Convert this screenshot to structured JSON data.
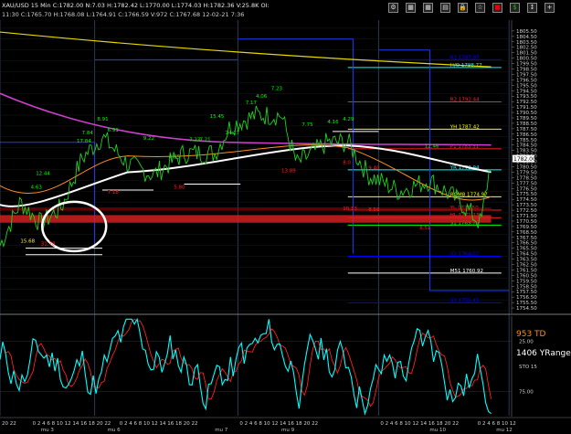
{
  "window": {
    "title_line": "XAU/USD 15 Min C:1782.00 N:7.03 H:1782.42 L:1770.00 L:1774.03 H:1782.36 V:25.8K OI:",
    "info_line": "11:30 C:1765.70 H:1768.08 L:1764.91 C:1766.59 V:972 C:1767.68 12-02-21 7:36",
    "buttons": [
      "settings-icon",
      "grid-icon",
      "grid-icon",
      "calendar-icon",
      "lock-icon",
      "star-icon",
      "red-square-icon",
      "dollar-icon",
      "scroll-icon",
      "crosshair-icon"
    ]
  },
  "chart_data": [
    {
      "type": "line",
      "title": "",
      "panel": "price",
      "yaxis": {
        "min": 1753.5,
        "max": 1807.5,
        "step": 1,
        "label_every": 1,
        "labels_from": 1754.5,
        "labels_to": 1805.5
      },
      "xaxis_labels": [
        "20 22",
        "0 2 4 6 8 10 12 14 16 18 20 22",
        "0 2 4 6 8 10 12 14 16 18 20 22",
        "0 2 4 6 8 10 12 14 16 18 20 22",
        "0 2 4 6 8 10 12 14 16 18 20 22",
        "0 2 4 6 8 10 12"
      ],
      "day_labels": [
        "mu 3",
        "mu 6",
        "mu 7",
        "mu 9",
        "mu 10",
        "mu 12"
      ],
      "price_box": {
        "value": "1782.00",
        "y": 1782.0
      },
      "levels": [
        {
          "label": "H/O 1798.77",
          "y": 1798.77,
          "color": "#00ffff"
        },
        {
          "label": "R1 1787.97",
          "y": 1800.2,
          "color": "#0000ff"
        },
        {
          "label": "R2 1792.44",
          "y": 1792.44,
          "color": "#ff2020"
        },
        {
          "label": "YH 1787.42",
          "y": 1787.42,
          "color": "#ffff00"
        },
        {
          "label": "P1 1783.31",
          "y": 1783.8,
          "color": "#ff2020"
        },
        {
          "label": "YR 1779.94",
          "y": 1779.94,
          "color": "#00ffff"
        },
        {
          "label": "ROM8 1774.97",
          "y": 1774.97,
          "color": "#ffff00"
        },
        {
          "label": "YL 1772.50",
          "y": 1772.5,
          "color": "#ff2020"
        },
        {
          "label": "HL 1771.13",
          "y": 1771.13,
          "color": "#ff2020"
        },
        {
          "label": "S1 1769.75",
          "y": 1769.75,
          "color": "#00ff00"
        },
        {
          "label": "S2 1764.02",
          "y": 1764.02,
          "color": "#0000ff"
        },
        {
          "label": "M51 1760.92",
          "y": 1760.92,
          "color": "#ffffff"
        },
        {
          "label": "S3 1755.45",
          "y": 1755.45,
          "color": "#0000ff"
        }
      ],
      "annotations": [
        {
          "text": "15.68",
          "x": 0.04,
          "y": 1766.5,
          "color": "#ffff00"
        },
        {
          "text": "4.63",
          "x": 0.06,
          "y": 1776.5,
          "color": "#00ff00"
        },
        {
          "text": "12.44",
          "x": 0.07,
          "y": 1779.0,
          "color": "#00ff00"
        },
        {
          "text": "31.78",
          "x": 0.08,
          "y": 1766.0,
          "color": "#ff2020"
        },
        {
          "text": "17.84",
          "x": 0.15,
          "y": 1785.0,
          "color": "#00ff00"
        },
        {
          "text": "7.84",
          "x": 0.16,
          "y": 1786.5,
          "color": "#00ff00"
        },
        {
          "text": "8.91",
          "x": 0.19,
          "y": 1789.0,
          "color": "#00ff00"
        },
        {
          "text": "6.91",
          "x": 0.21,
          "y": 1787.0,
          "color": "#00ff00"
        },
        {
          "text": "9.22",
          "x": 0.28,
          "y": 1785.5,
          "color": "#00ff00"
        },
        {
          "text": "7.18",
          "x": 0.21,
          "y": 1775.5,
          "color": "#ff2020"
        },
        {
          "text": "5.80",
          "x": 0.34,
          "y": 1776.5,
          "color": "#ff2020"
        },
        {
          "text": "4.65",
          "x": 0.33,
          "y": 1782.0,
          "color": "#00ff00"
        },
        {
          "text": "7.23",
          "x": 0.37,
          "y": 1785.2,
          "color": "#00ff00"
        },
        {
          "text": "7.21",
          "x": 0.39,
          "y": 1785.2,
          "color": "#00ff00"
        },
        {
          "text": "15.45",
          "x": 0.41,
          "y": 1789.5,
          "color": "#00ff00"
        },
        {
          "text": "14.17",
          "x": 0.44,
          "y": 1786.5,
          "color": "#00ff00"
        },
        {
          "text": "4.06",
          "x": 0.5,
          "y": 1793.2,
          "color": "#00ff00"
        },
        {
          "text": "7.23",
          "x": 0.53,
          "y": 1794.6,
          "color": "#00ff00"
        },
        {
          "text": "7.17",
          "x": 0.48,
          "y": 1792.0,
          "color": "#00ff00"
        },
        {
          "text": "7.75",
          "x": 0.59,
          "y": 1788.0,
          "color": "#00ff00"
        },
        {
          "text": "4.16",
          "x": 0.64,
          "y": 1788.5,
          "color": "#00ff00"
        },
        {
          "text": "4.29",
          "x": 0.67,
          "y": 1789.0,
          "color": "#00ff00"
        },
        {
          "text": "13.89",
          "x": 0.55,
          "y": 1779.5,
          "color": "#ff2020"
        },
        {
          "text": "8.0",
          "x": 0.67,
          "y": 1781.0,
          "color": "#ff2020"
        },
        {
          "text": "9.40",
          "x": 0.72,
          "y": 1780.0,
          "color": "#ff2020"
        },
        {
          "text": "10.13",
          "x": 0.67,
          "y": 1772.5,
          "color": "#ff2020"
        },
        {
          "text": "8.58",
          "x": 0.72,
          "y": 1772.3,
          "color": "#ff2020"
        },
        {
          "text": "12.46",
          "x": 0.83,
          "y": 1784.0,
          "color": "#00ff00"
        },
        {
          "text": "8.51",
          "x": 0.82,
          "y": 1769.0,
          "color": "#ff2020"
        }
      ]
    },
    {
      "type": "line",
      "title": "",
      "panel": "oscillator",
      "yaxis_labels": [
        "25.00",
        "STO 15",
        "75.00"
      ],
      "labels": [
        {
          "text": "953 TD",
          "color": "#ff9000"
        },
        {
          "text": "1406 YRange",
          "color": "#ffffff"
        }
      ],
      "series": [
        {
          "name": "STO",
          "color": "#00ffff"
        },
        {
          "name": "Signal",
          "color": "#ff2020"
        }
      ]
    }
  ]
}
